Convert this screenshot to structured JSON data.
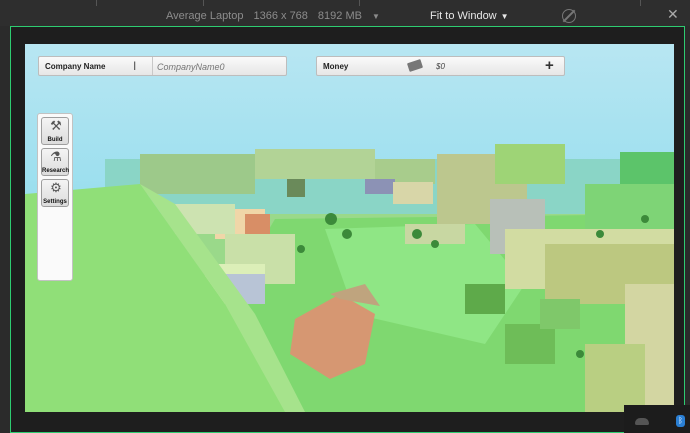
{
  "toolbar": {
    "device": "Average Laptop",
    "resolution": "1366 x 768",
    "memory": "8192 MB",
    "zoom": "Fit to Window"
  },
  "hud": {
    "company_label": "Company Name",
    "company_placeholder": "CompanyName0",
    "money_label": "Money",
    "money_value": "$0",
    "add_label": "+"
  },
  "sidebar": {
    "items": [
      {
        "label": "Build",
        "icon": "tools-icon"
      },
      {
        "label": "Research",
        "icon": "flask-icon"
      },
      {
        "label": "Settings",
        "icon": "gear-icon"
      }
    ]
  },
  "colors": {
    "frame_border": "#2ecc71",
    "sky": "#7fd6ee",
    "grass": "#8ed876"
  }
}
